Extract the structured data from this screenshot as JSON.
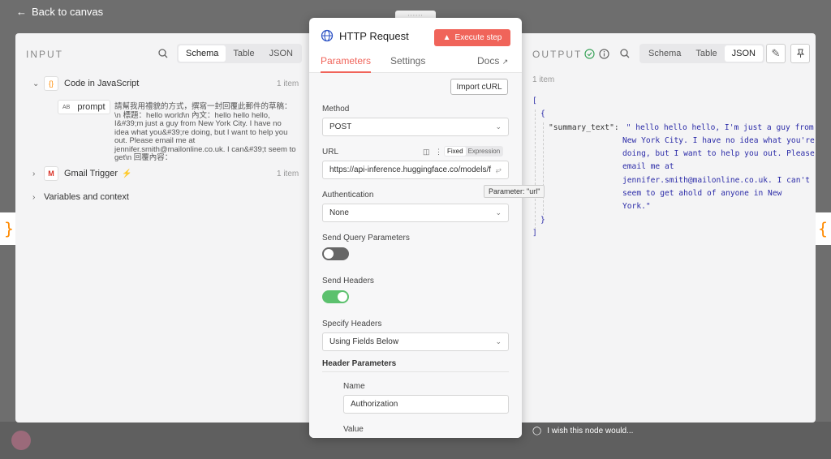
{
  "topbar": {
    "back_label": "Back to canvas"
  },
  "side_tabs": {
    "left_glyph": "}",
    "right_glyph": "{"
  },
  "input_panel": {
    "title": "INPUT",
    "view_tabs": [
      "Schema",
      "Table",
      "JSON"
    ],
    "active_view": "Schema",
    "nodes": [
      {
        "name": "Code in JavaScript",
        "icon": "code-braces-icon",
        "count": "1 item",
        "expanded": true
      },
      {
        "name": "Gmail Trigger",
        "icon": "gmail-icon",
        "count": "1 item",
        "expanded": false
      },
      {
        "name": "Variables and context",
        "expanded": false
      }
    ],
    "field": {
      "type_badge": "AB",
      "name": "prompt",
      "value": "請幫我用禮貌的方式，撰寫一封回覆此郵件的草稿：\\n 標題：hello world\\n 內文：hello hello hello, I&#39;m just a guy from New York City. I have no idea what you&#39;re doing, but I want to help you out. Please email me at jennifer.smith@mailonline.co.uk. I can&#39;t seem to get\\n 回覆內容："
    }
  },
  "node_panel": {
    "handle": "::::::",
    "title": "HTTP Request",
    "execute_label": "Execute step",
    "tabs": [
      "Parameters",
      "Settings"
    ],
    "active_tab": "Parameters",
    "docs_label": "Docs",
    "import_curl": "Import cURL",
    "method": {
      "label": "Method",
      "value": "POST"
    },
    "url": {
      "label": "URL",
      "value": "https://api-inference.huggingface.co/models/f",
      "modes": [
        "Fixed",
        "Expression"
      ],
      "active_mode": "Fixed"
    },
    "authentication": {
      "label": "Authentication",
      "value": "None"
    },
    "send_query": {
      "label": "Send Query Parameters",
      "on": false
    },
    "send_headers": {
      "label": "Send Headers",
      "on": true
    },
    "specify_headers": {
      "label": "Specify Headers",
      "value": "Using Fields Below"
    },
    "header_params": {
      "label": "Header Parameters",
      "name_label": "Name",
      "name_value": "Authorization",
      "value_label": "Value"
    },
    "tooltip": "Parameter: \"url\""
  },
  "output_panel": {
    "title": "OUTPUT",
    "view_tabs": [
      "Schema",
      "Table",
      "JSON"
    ],
    "active_view": "JSON",
    "item_count": "1 item",
    "json": {
      "open_array": "[",
      "open_obj": "{",
      "key": "\"summary_text\":",
      "value_lines": [
        "\" hello hello hello, I'm just a guy from",
        "New York City. I have no idea what you're",
        "doing, but I want to help you out. Please",
        "email me at",
        "jennifer.smith@mailonline.co.uk. I can't",
        "seem to get ahold of anyone in New",
        "York.\""
      ],
      "close_obj": "}",
      "close_array": "]"
    },
    "footer_hint": "I wish this node would..."
  },
  "colors": {
    "accent": "#f0645a",
    "switch_on": "#5cc16e",
    "switch_off": "#666666",
    "json_string": "#2c2ca8"
  }
}
